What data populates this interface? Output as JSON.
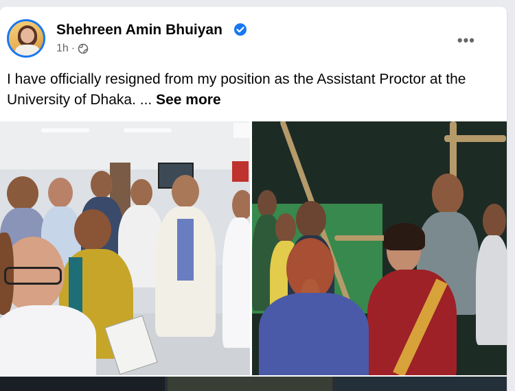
{
  "post": {
    "author": "Shehreen Amin Bhuiyan",
    "verified_icon": "verified-badge-icon",
    "time": "1h",
    "separator": "·",
    "audience_icon": "globe-icon",
    "more_label": "•••",
    "text": "I have officially resigned from my position as the Assistant Proctor at the University of Dhaka. ...",
    "see_more": "See more"
  },
  "colors": {
    "accent": "#1877f2",
    "text": "#050505",
    "secondary": "#65676b"
  }
}
